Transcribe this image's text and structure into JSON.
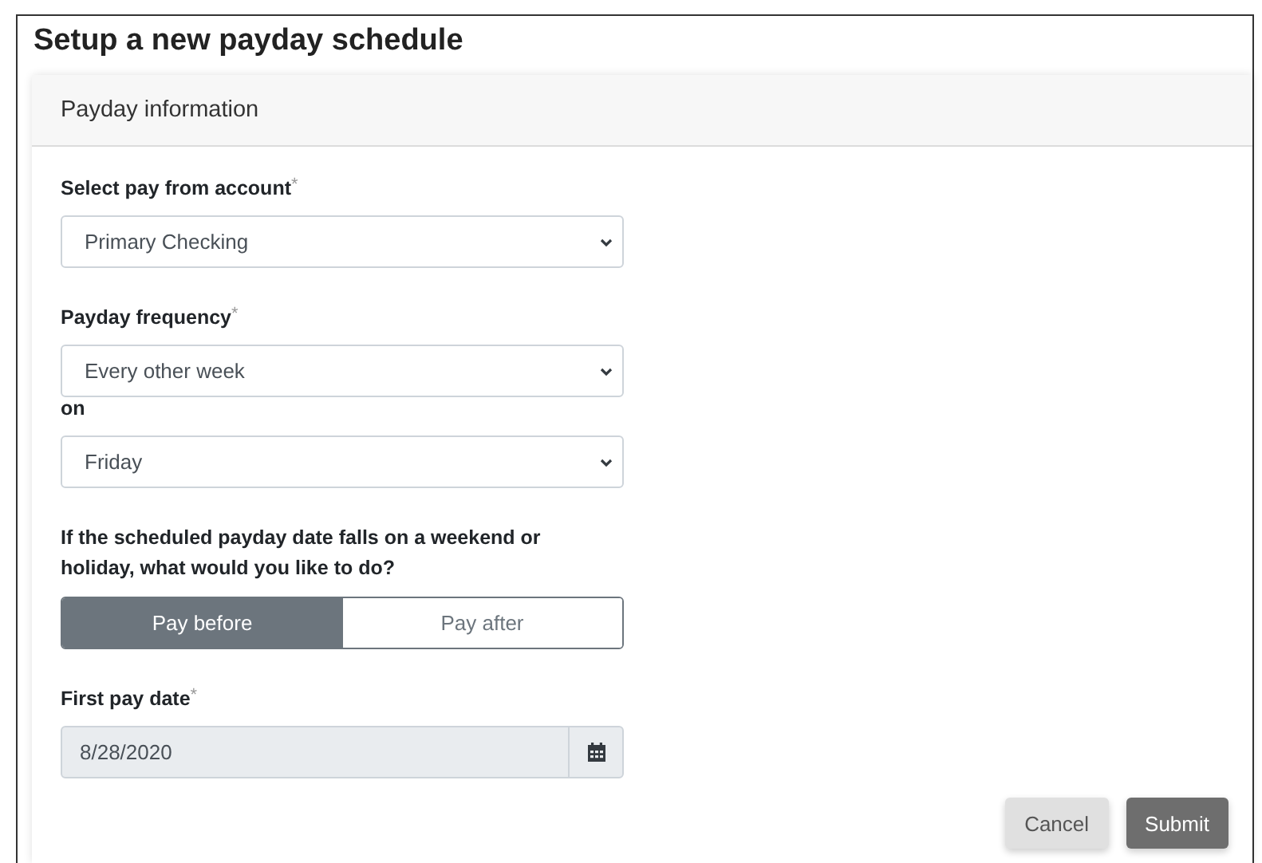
{
  "page": {
    "title": "Setup a new payday schedule"
  },
  "card": {
    "header": "Payday information"
  },
  "fields": [
    {
      "kind": "select",
      "label": "Select pay from account",
      "required_mark": "*",
      "value": "Primary Checking"
    },
    {
      "kind": "select",
      "label": "Payday frequency",
      "required_mark": "*",
      "value": "Every other week"
    },
    {
      "kind": "inline_select",
      "label": "on",
      "value": "Friday"
    },
    {
      "kind": "choice",
      "label": "If the scheduled payday date falls on a weekend or holiday, what would you like to do?",
      "options": [
        {
          "label": "Pay before",
          "selected": true
        },
        {
          "label": "Pay after",
          "selected": false
        }
      ]
    },
    {
      "kind": "date",
      "label": "First pay date",
      "required_mark": "*",
      "value": "8/28/2020",
      "disabled": true
    }
  ],
  "buttons": [
    {
      "label": "Cancel",
      "kind": "secondary"
    },
    {
      "label": "Submit",
      "kind": "primary"
    }
  ]
}
